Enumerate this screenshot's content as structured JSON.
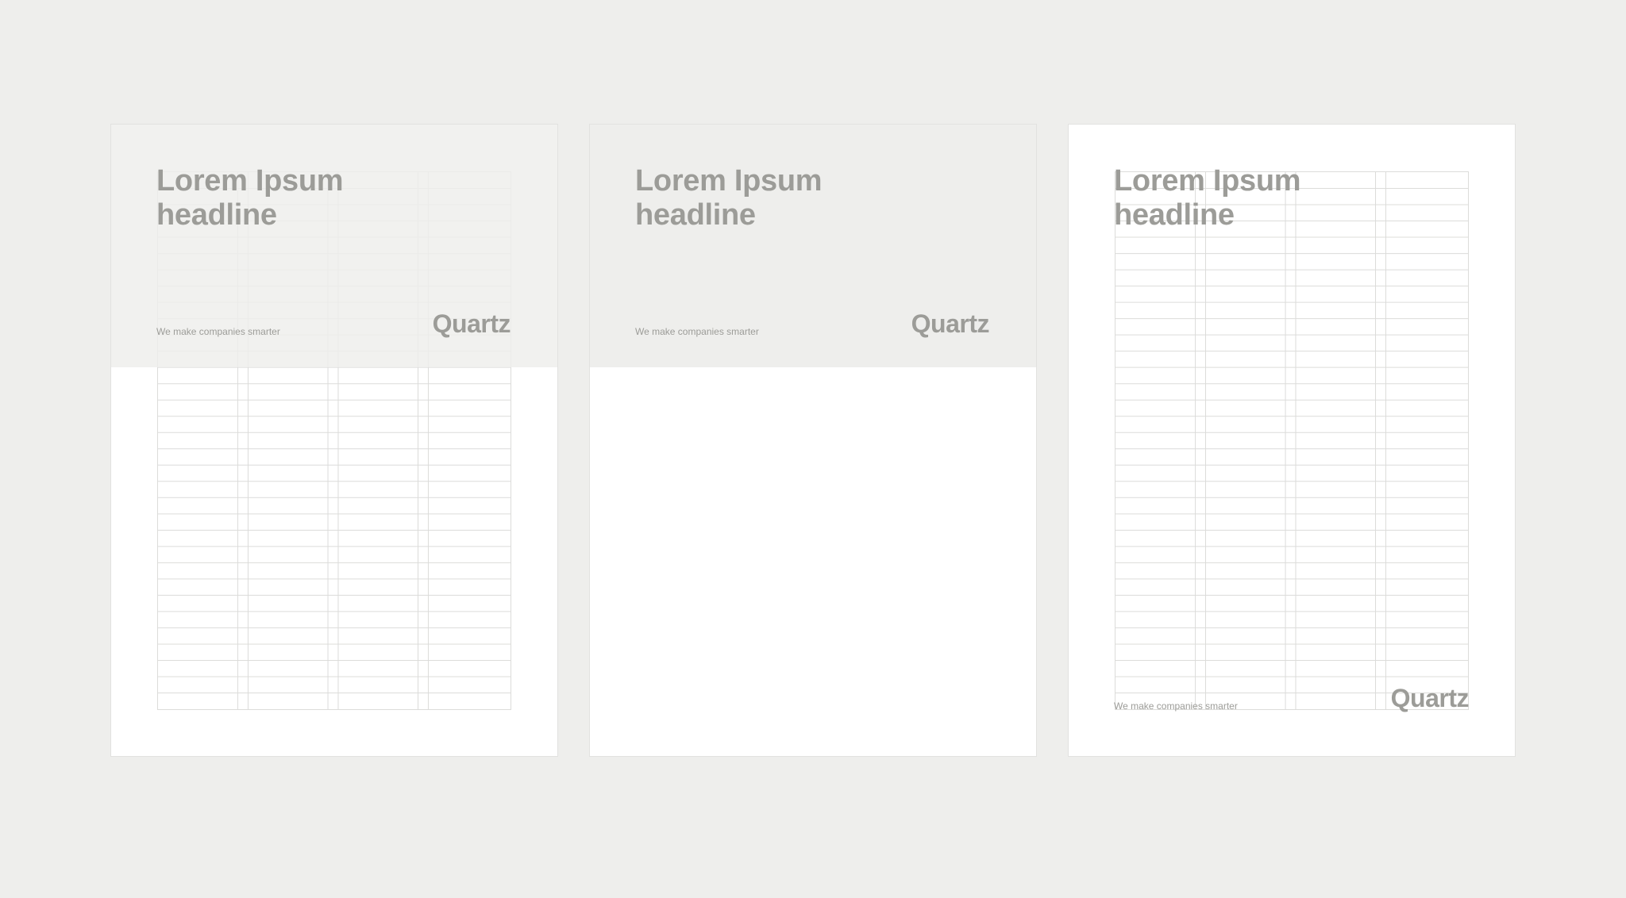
{
  "pages": [
    {
      "headline": [
        "Lorem Ipsum",
        "headline"
      ],
      "tagline": "We make companies smarter",
      "logo": "Quartz"
    },
    {
      "headline": [
        "Lorem Ipsum",
        "headline"
      ],
      "tagline": "We make companies smarter",
      "logo": "Quartz"
    },
    {
      "headline": [
        "Lorem Ipsum",
        "headline"
      ],
      "tagline": "We make companies smarter",
      "logo": "Quartz"
    }
  ],
  "colors": {
    "background": "#eeeeec",
    "page": "#ffffff",
    "text": "#9c9c98",
    "grid_line": "#dcdcda"
  }
}
